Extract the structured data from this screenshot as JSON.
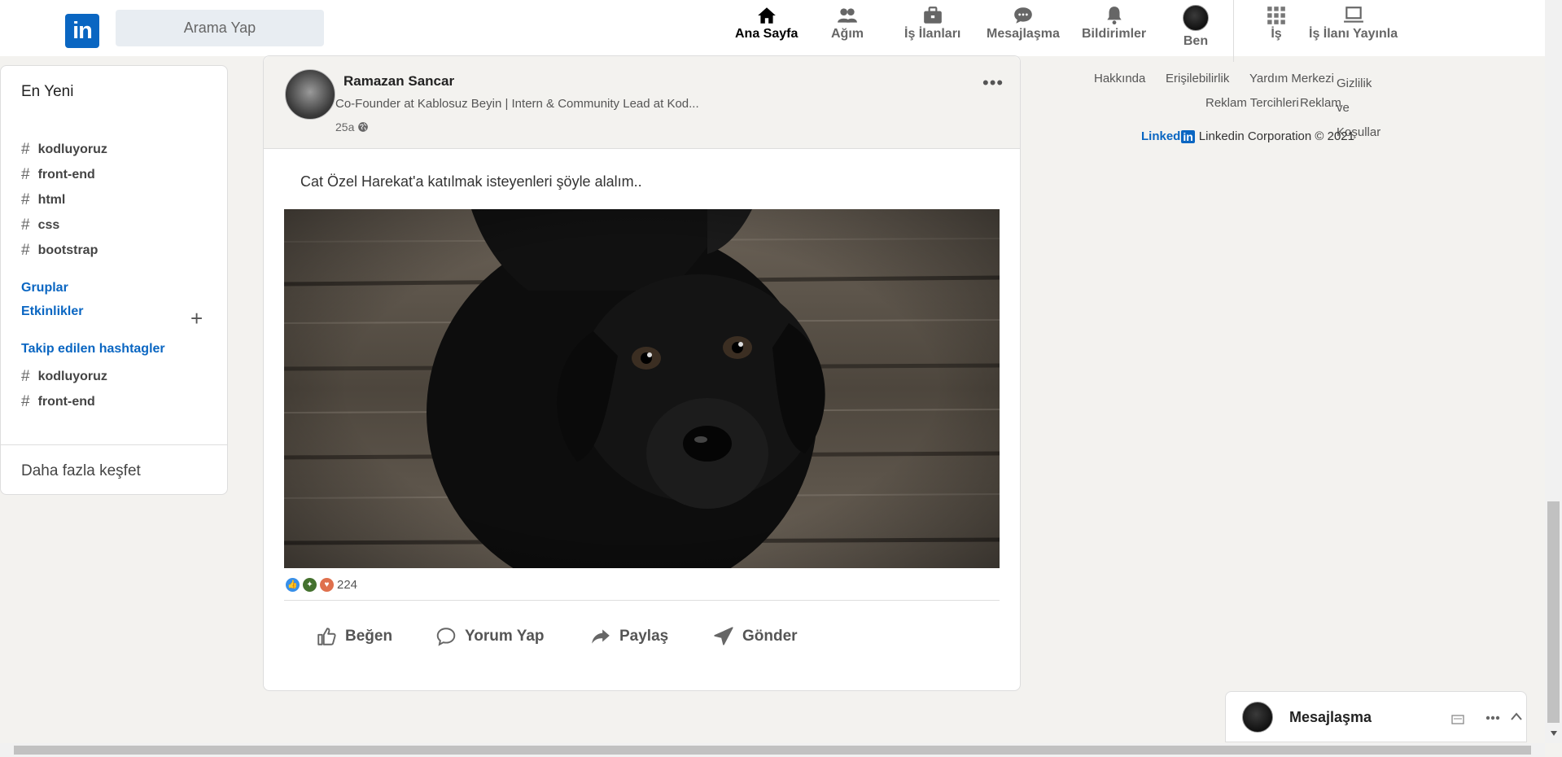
{
  "header": {
    "logo_text": "in",
    "search_placeholder": "Arama Yap",
    "nav": [
      {
        "label": "Ana Sayfa",
        "icon": "home-icon"
      },
      {
        "label": "Ağım",
        "icon": "network-icon"
      },
      {
        "label": "İş İlanları",
        "icon": "briefcase-icon"
      },
      {
        "label": "Mesajlaşma",
        "icon": "chat-icon"
      },
      {
        "label": "Bildirimler",
        "icon": "bell-icon"
      },
      {
        "label": "Ben",
        "icon": "avatar"
      },
      {
        "label": "İş",
        "icon": "grid-icon"
      },
      {
        "label": "İş İlanı Yayınla",
        "icon": "laptop-icon"
      }
    ]
  },
  "sidebar": {
    "title": "En Yeni",
    "recent_tags": [
      "kodluyoruz",
      "front-end",
      "html",
      "css",
      "bootstrap"
    ],
    "groups_label": "Gruplar",
    "events_label": "Etkinlikler",
    "plus_label": "+",
    "followed_label": "Takip edilen hashtagler",
    "followed_tags": [
      "kodluyoruz",
      "front-end"
    ],
    "hash_symbol": "#",
    "more_label": "Daha fazla keşfet"
  },
  "post": {
    "author": "Ramazan Sancar",
    "headline": "Co-Founder at Kablosuz Beyin | Intern & Community Lead at Kod...",
    "time": "25a",
    "menu": "•••",
    "text": "Cat Özel Harekat'a katılmak isteyenleri şöyle alalım..",
    "reaction_count": "224",
    "actions": {
      "like": "Beğen",
      "comment": "Yorum Yap",
      "share": "Paylaş",
      "send": "Gönder"
    }
  },
  "footer": {
    "links": [
      "Hakkında",
      "Erişilebilirlik",
      "Yardım Merkezi",
      "Gizlilik ve Koşullar",
      "Reklam Tercihleri",
      "Reklam"
    ],
    "logo_text": "Linked",
    "logo_in": "in",
    "copyright": "Linkedin Corporation © 2021"
  },
  "messaging": {
    "title": "Mesajlaşma"
  },
  "colors": {
    "brand": "#0a66c2",
    "background": "#f3f2ef"
  }
}
